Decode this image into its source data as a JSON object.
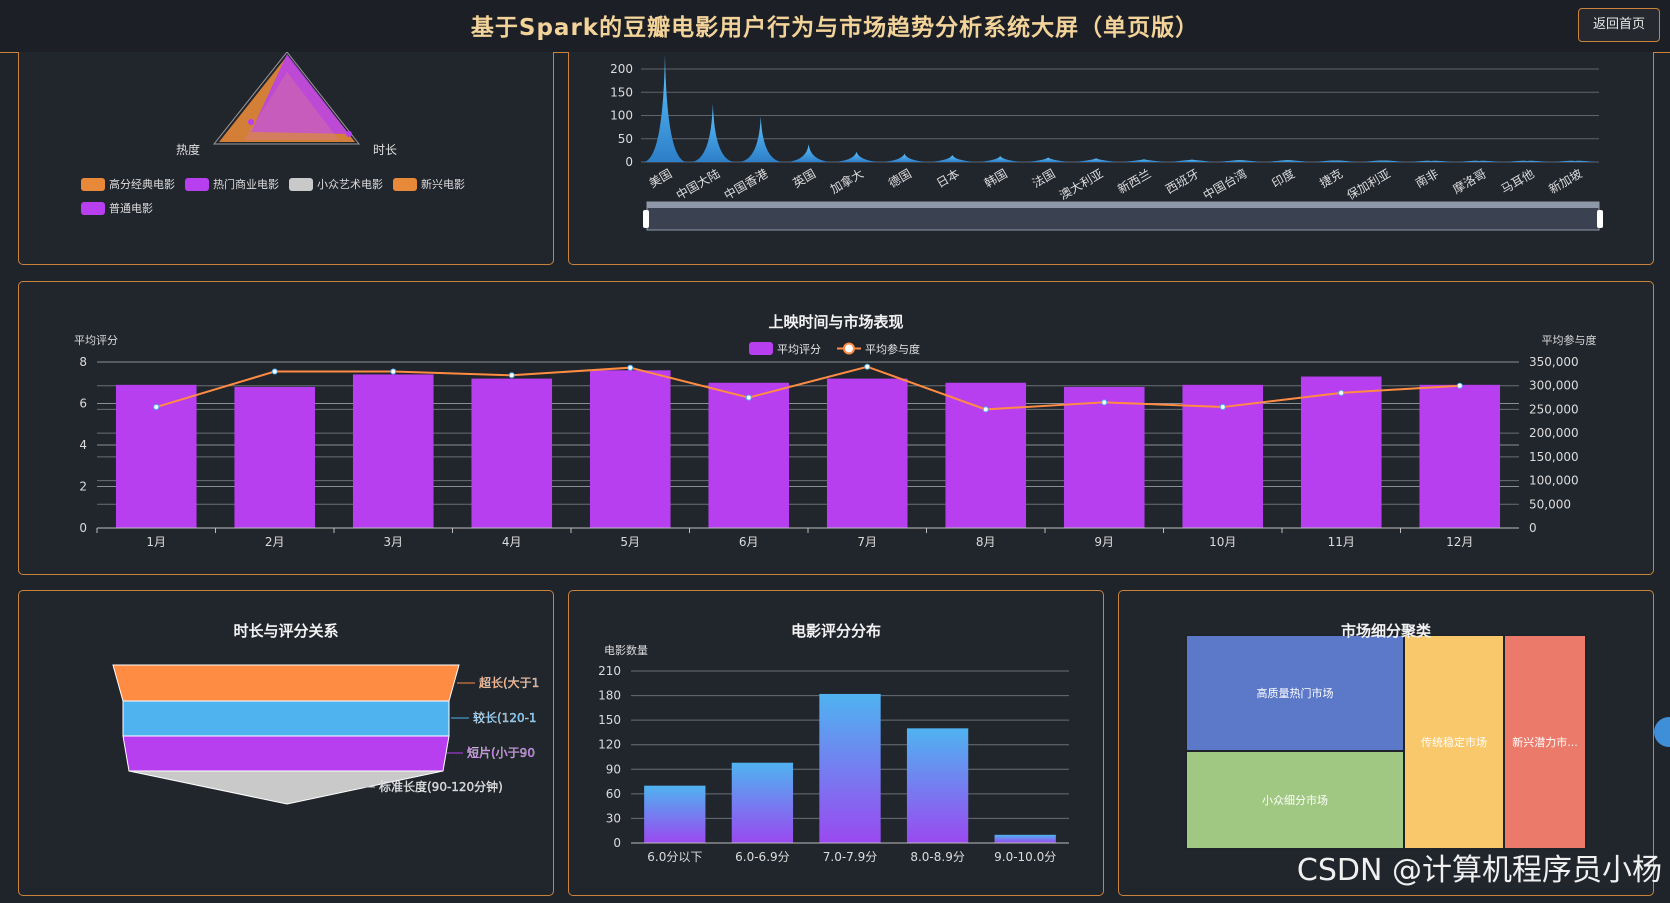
{
  "header": {
    "title": "基于Spark的豆瓣电影用户行为与市场趋势分析系统大屏（单页版）",
    "back_label": "返回首页"
  },
  "radar": {
    "labels": [
      "热度",
      "时长"
    ],
    "legend": [
      {
        "name": "高分经典电影",
        "color": "#e8893a"
      },
      {
        "name": "热门商业电影",
        "color": "#b83ff0"
      },
      {
        "name": "小众艺术电影",
        "color": "#c9c9c9"
      },
      {
        "name": "新兴电影",
        "color": "#e8893a"
      },
      {
        "name": "普通电影",
        "color": "#b83ff0"
      }
    ]
  },
  "region_chart": {
    "yticks": [
      "200",
      "150",
      "100",
      "50",
      "0"
    ],
    "regions": [
      "美国",
      "中国大陆",
      "中国香港",
      "英国",
      "加拿大",
      "德国",
      "日本",
      "韩国",
      "法国",
      "澳大利亚",
      "新西兰",
      "西班牙",
      "中国台湾",
      "印度",
      "捷克",
      "保加利亚",
      "南非",
      "摩洛哥",
      "马耳他",
      "新加坡"
    ],
    "values": [
      230,
      125,
      98,
      38,
      22,
      18,
      15,
      13,
      10,
      8,
      6,
      5,
      4,
      4,
      3,
      3,
      2,
      2,
      2,
      2
    ],
    "ymax": 200
  },
  "release_chart": {
    "title": "上映时间与市场表现",
    "left_axis": "平均评分",
    "right_axis": "平均参与度",
    "legend_bar": "平均评分",
    "legend_line": "平均参与度",
    "months": [
      "1月",
      "2月",
      "3月",
      "4月",
      "5月",
      "6月",
      "7月",
      "8月",
      "9月",
      "10月",
      "11月",
      "12月"
    ],
    "ratings": [
      6.9,
      6.8,
      7.4,
      7.2,
      7.6,
      7.0,
      7.2,
      7.0,
      6.8,
      6.9,
      7.3,
      6.9
    ],
    "engagement": [
      255000,
      330000,
      330000,
      322000,
      338000,
      275000,
      340000,
      250000,
      265000,
      255000,
      285000,
      300000
    ],
    "left_ticks": [
      "8",
      "6",
      "4",
      "2",
      "0"
    ],
    "right_ticks": [
      "350,000",
      "300,000",
      "250,000",
      "200,000",
      "150,000",
      "100,000",
      "50,000",
      "0"
    ]
  },
  "duration_chart": {
    "title": "时长与评分关系",
    "layers": [
      {
        "label": "超长(大于1",
        "color": "#ff8c42"
      },
      {
        "label": "较长(120-1",
        "color": "#4fb3f0"
      },
      {
        "label": "短片(小于90",
        "color": "#b83ff0"
      },
      {
        "label": "标准长度(90-120分钟)",
        "color": "#c9c9c9"
      }
    ]
  },
  "rating_dist": {
    "title": "电影评分分布",
    "ylabel": "电影数量",
    "categories": [
      "6.0分以下",
      "6.0-6.9分",
      "7.0-7.9分",
      "8.0-8.9分",
      "9.0-10.0分"
    ],
    "values": [
      70,
      98,
      182,
      140,
      10
    ],
    "yticks": [
      "210",
      "180",
      "150",
      "120",
      "90",
      "60",
      "30",
      "0"
    ],
    "ymax": 210
  },
  "segment": {
    "title": "市场细分聚类",
    "cells": [
      {
        "label": "高质量热门市场",
        "color": "#5b78c9"
      },
      {
        "label": "小众细分市场",
        "color": "#a0c882"
      },
      {
        "label": "传统稳定市场",
        "color": "#f9c86a"
      },
      {
        "label": "新兴潜力市...",
        "color": "#ec7a6a"
      }
    ]
  },
  "watermark": "CSDN @计算机程序员小杨"
}
